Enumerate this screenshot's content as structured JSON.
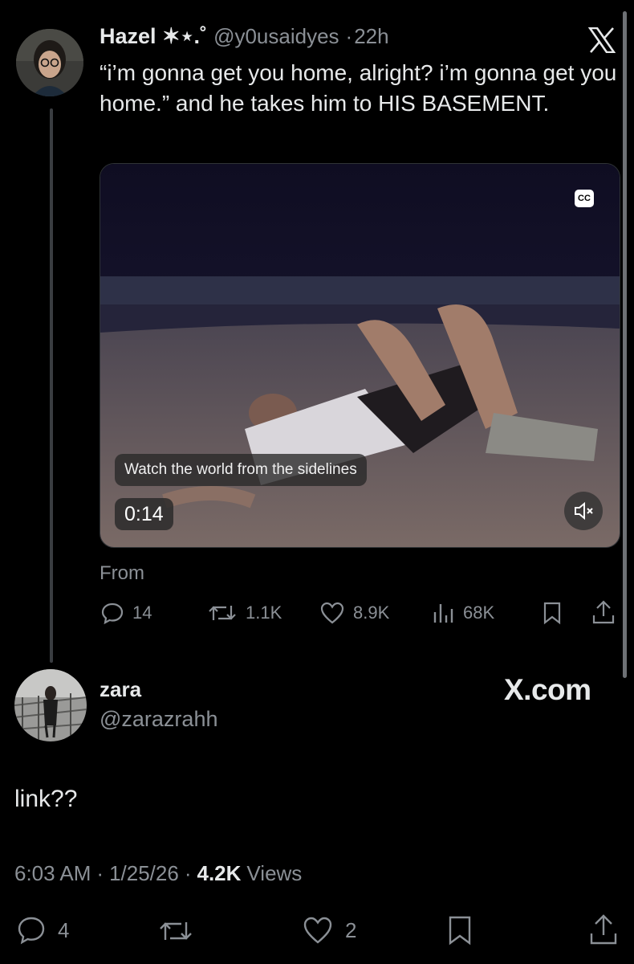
{
  "quoted_tweet": {
    "author_name": "Hazel ✶⋆.˚",
    "handle": "@y0usaidyes",
    "separator": "·",
    "time": "22h",
    "text": "“i’m gonna get you home, alright? i’m gonna get you home.” and he takes him to HIS BASEMENT.",
    "video": {
      "caption": "Watch the world from the sidelines",
      "duration": "0:14",
      "cc_label": "CC"
    },
    "from_label": "From",
    "stats": {
      "replies": "14",
      "reposts": "1.1K",
      "likes": "8.9K",
      "views": "68K"
    }
  },
  "reply_tweet": {
    "author_name": "zara",
    "handle": "@zarazrahh",
    "watermark": "X.com",
    "text": "link??",
    "time": "6:03 AM",
    "date": "1/25/26",
    "separator": "·",
    "views_count": "4.2K",
    "views_label": "Views",
    "stats": {
      "replies": "4",
      "likes": "2"
    }
  },
  "icons": [
    "x-logo-icon",
    "reply-icon",
    "repost-icon",
    "like-icon",
    "views-icon",
    "bookmark-icon",
    "share-icon",
    "cc-icon",
    "mute-icon"
  ]
}
